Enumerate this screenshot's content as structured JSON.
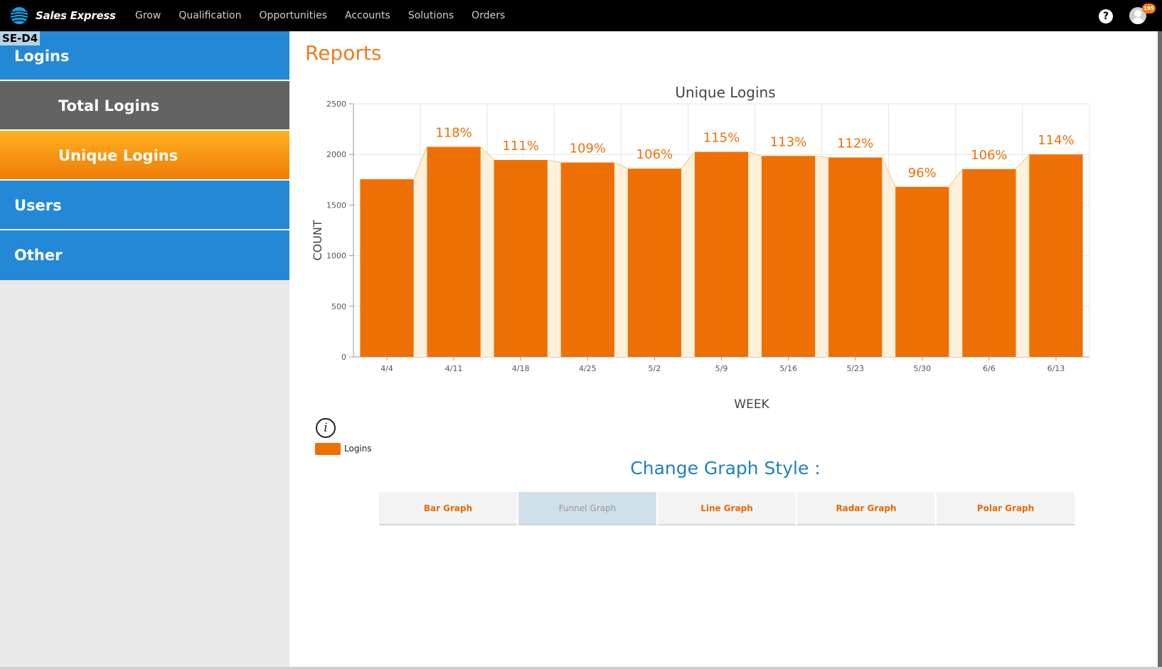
{
  "header": {
    "brand": "Sales Express",
    "brand_icon": "att-globe-icon",
    "nav": [
      "Grow",
      "Qualification",
      "Opportunities",
      "Accounts",
      "Solutions",
      "Orders"
    ],
    "help_label": "?",
    "notification_count": "195",
    "accent_color": "#f07a1a"
  },
  "env_tag": "SE-D4",
  "sidebar": {
    "items": [
      {
        "label": "Logins",
        "style": "blue"
      },
      {
        "label": "Total Logins",
        "style": "gray"
      },
      {
        "label": "Unique Logins",
        "style": "orange-selected"
      },
      {
        "label": "Users",
        "style": "blue"
      },
      {
        "label": "Other",
        "style": "blue"
      }
    ]
  },
  "page": {
    "title": "Reports"
  },
  "legend": {
    "label": "Logins",
    "info_icon": "info-icon"
  },
  "change_style": {
    "title": "Change Graph Style :",
    "buttons": [
      "Bar Graph",
      "Funnel Graph",
      "Line Graph",
      "Radar Graph",
      "Polar Graph"
    ],
    "active": "Funnel Graph"
  },
  "chart_data": {
    "type": "bar",
    "title": "Unique Logins",
    "xlabel": "WEEK",
    "ylabel": "COUNT",
    "ylim": [
      0,
      2500
    ],
    "yticks": [
      0,
      500,
      1000,
      1500,
      2000,
      2500
    ],
    "grid": true,
    "categories": [
      "4/4",
      "4/11",
      "4/18",
      "4/25",
      "5/2",
      "5/9",
      "5/16",
      "5/23",
      "5/30",
      "6/6",
      "6/13"
    ],
    "series": [
      {
        "name": "Logins",
        "values": [
          1755,
          2075,
          1945,
          1920,
          1860,
          2025,
          1985,
          1970,
          1680,
          1855,
          2000
        ],
        "color": "#ee7004"
      }
    ],
    "data_labels": [
      "",
      "118%",
      "111%",
      "109%",
      "106%",
      "115%",
      "113%",
      "112%",
      "96%",
      "106%",
      "114%"
    ],
    "funnel_fill": "#fdf1dc",
    "funnel_line": "#f5c97a"
  }
}
